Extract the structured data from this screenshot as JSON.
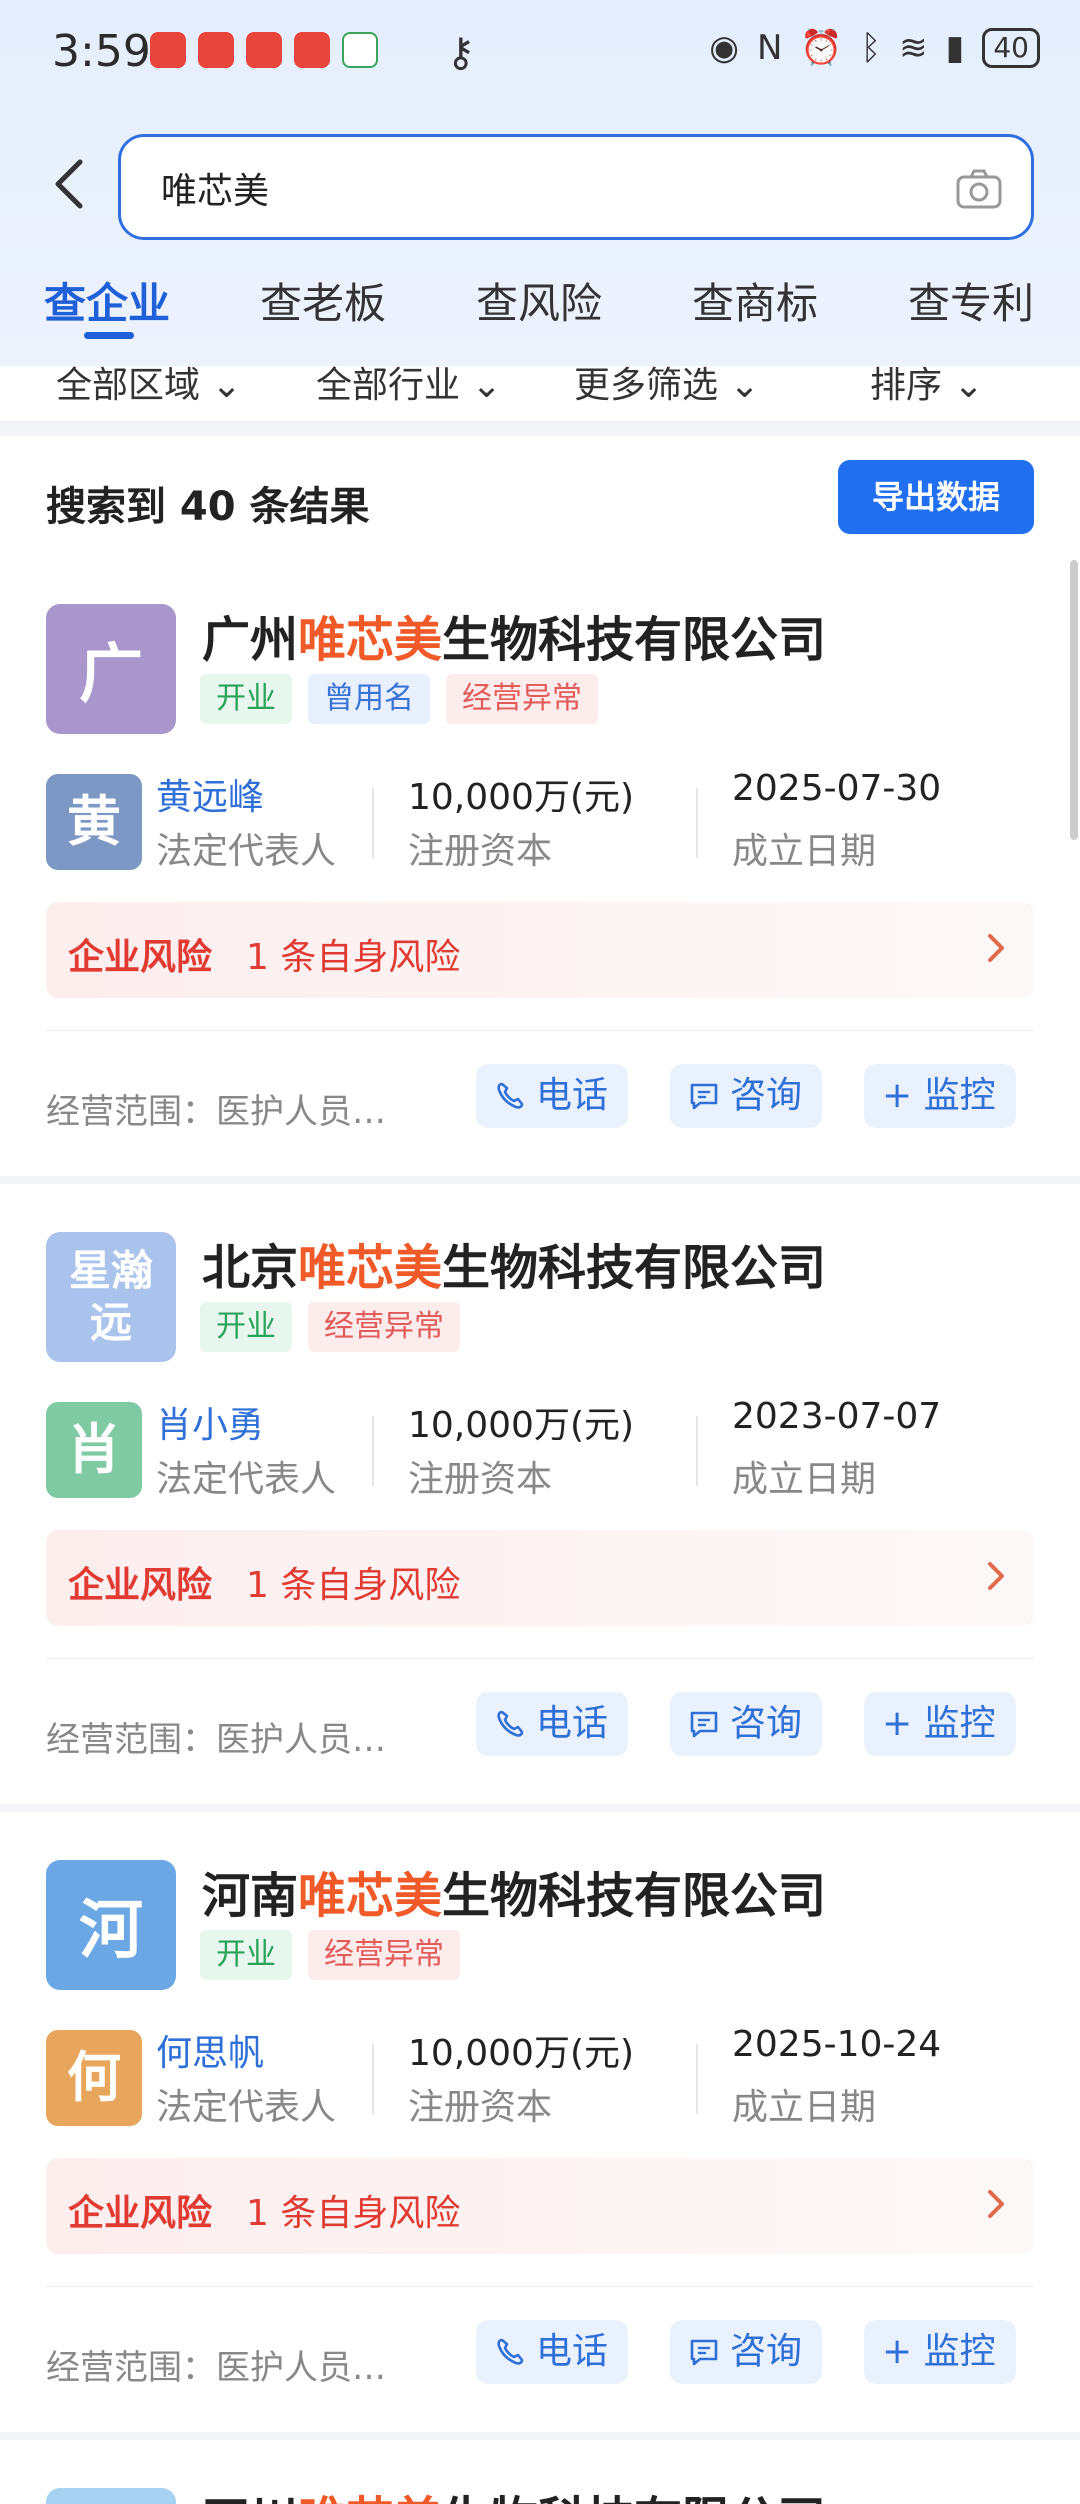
{
  "status_bar": {
    "time": "3:59",
    "battery": "40"
  },
  "search": {
    "value": "唯芯美"
  },
  "tabs": [
    "查企业",
    "查老板",
    "查风险",
    "查商标",
    "查专利"
  ],
  "filters": [
    "全部区域",
    "全部行业",
    "更多筛选",
    "排序"
  ],
  "results": {
    "count_text": "搜索到 40 条结果",
    "export_label": "导出数据"
  },
  "labels": {
    "legal_rep": "法定代表人",
    "reg_capital": "注册资本",
    "founded": "成立日期",
    "risk_label": "企业风险",
    "risk_count": "1 条自身风险",
    "scope": "经营范围：医护人员…",
    "phone": "电话",
    "consult": "咨询",
    "monitor": "+ 监控"
  },
  "companies": [
    {
      "logo_text": "广",
      "logo_color": "#a996cc",
      "name_prefix": "广州",
      "name_highlight": "唯芯美",
      "name_suffix": "生物科技有限公司",
      "tags": [
        "开业",
        "曾用名",
        "经营异常"
      ],
      "person": "黄远峰",
      "person_initial": "黄",
      "person_color": "#7d98c4",
      "capital": "10,000万(元)",
      "date": "2025-07-30"
    },
    {
      "logo_text": "星瀚远",
      "logo_color": "#a9c3ec",
      "name_prefix": "北京",
      "name_highlight": "唯芯美",
      "name_suffix": "生物科技有限公司",
      "tags": [
        "开业",
        "经营异常"
      ],
      "person": "肖小勇",
      "person_initial": "肖",
      "person_color": "#7fcaa3",
      "capital": "10,000万(元)",
      "date": "2023-07-07"
    },
    {
      "logo_text": "河",
      "logo_color": "#6aa7e4",
      "name_prefix": "河南",
      "name_highlight": "唯芯美",
      "name_suffix": "生物科技有限公司",
      "tags": [
        "开业",
        "经营异常"
      ],
      "person": "何思帆",
      "person_initial": "何",
      "person_color": "#e7a65c",
      "capital": "10,000万(元)",
      "date": "2025-10-24"
    }
  ],
  "partial_company": {
    "name_prefix": "四川",
    "name_highlight": "唯芯美",
    "name_suffix": "生物科技有限公司"
  }
}
